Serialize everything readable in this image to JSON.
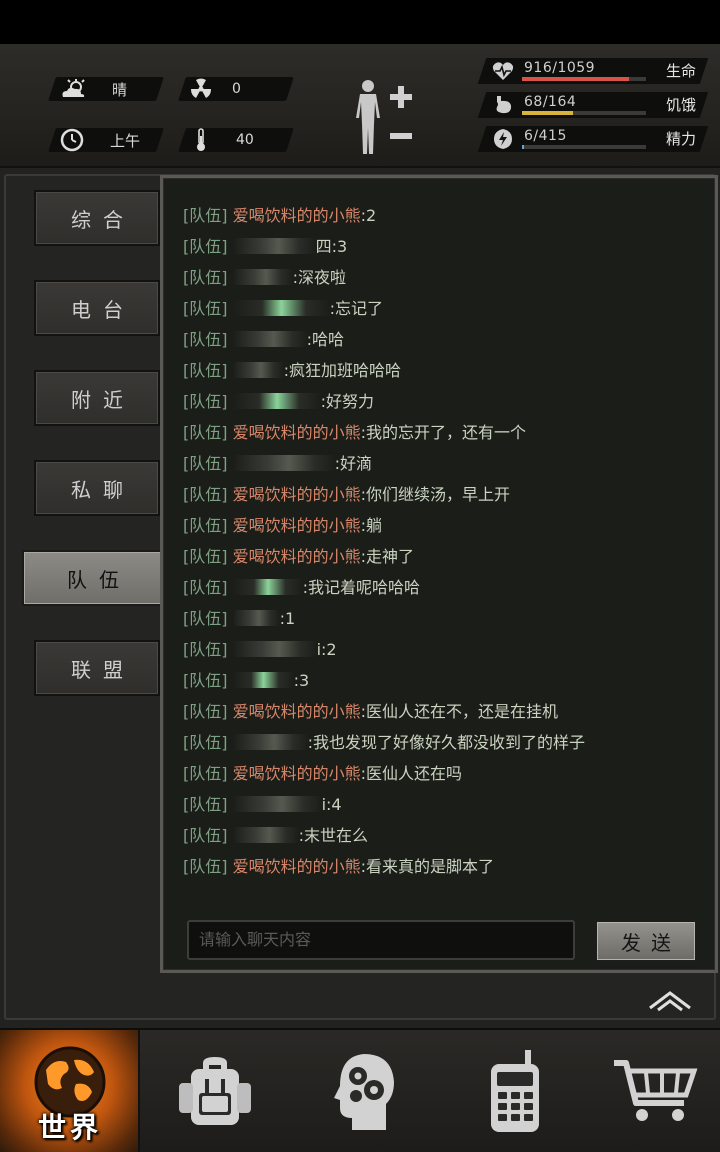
{
  "hud": {
    "weather": {
      "icon": "partly-cloudy-icon",
      "label": "晴"
    },
    "radiation": {
      "icon": "radiation-icon",
      "value": "0"
    },
    "time": {
      "icon": "clock-icon",
      "label": "上午"
    },
    "temperature": {
      "icon": "thermometer-icon",
      "value": "40"
    },
    "stats": [
      {
        "name": "生命",
        "value": "916/1059",
        "current": 916,
        "max": 1059,
        "color": "#d8534a",
        "icon": "heart-icon"
      },
      {
        "name": "饥饿",
        "value": "68/164",
        "current": 68,
        "max": 164,
        "color": "#d9b43a",
        "icon": "stomach-icon"
      },
      {
        "name": "精力",
        "value": "6/415",
        "current": 6,
        "max": 415,
        "color": "#6aa3d1",
        "icon": "energy-icon"
      }
    ]
  },
  "side_tabs": [
    {
      "label": "综合",
      "active": false
    },
    {
      "label": "电台",
      "active": false
    },
    {
      "label": "附近",
      "active": false
    },
    {
      "label": "私聊",
      "active": false
    },
    {
      "label": "队伍",
      "active": true
    },
    {
      "label": "联盟",
      "active": false
    }
  ],
  "chat": {
    "channel_label": "[队伍]",
    "messages": [
      {
        "name": "爱喝饮料的的小熊",
        "text": ":2"
      },
      {
        "name": "",
        "tail": "四",
        "text": ":3"
      },
      {
        "name": "",
        "tail": "",
        "text": ":深夜啦"
      },
      {
        "name": "",
        "tail": "",
        "text": ":忘记了"
      },
      {
        "name": "",
        "tail": "",
        "text": ":哈哈"
      },
      {
        "name": "",
        "tail": "",
        "text": ":疯狂加班哈哈哈"
      },
      {
        "name": "",
        "tail": "",
        "text": ":好努力"
      },
      {
        "name": "爱喝饮料的的小熊",
        "text": ":我的忘开了，还有一个"
      },
      {
        "name": "",
        "tail": "",
        "text": ":好滴"
      },
      {
        "name": "爱喝饮料的的小熊",
        "text": ":你们继续汤，早上开"
      },
      {
        "name": "爱喝饮料的的小熊",
        "text": ":躺"
      },
      {
        "name": "爱喝饮料的的小熊",
        "text": ":走神了"
      },
      {
        "name": "",
        "tail": "",
        "text": ":我记着呢哈哈哈"
      },
      {
        "name": "",
        "tail": "",
        "text": ":1"
      },
      {
        "name": "",
        "tail": "",
        "text": "i:2"
      },
      {
        "name": "",
        "tail": "",
        "text": ":3"
      },
      {
        "name": "爱喝饮料的的小熊",
        "text": ":医仙人还在不，还是在挂机"
      },
      {
        "name": "",
        "tail": "",
        "text": ":我也发现了好像好久都没收到了的样子"
      },
      {
        "name": "爱喝饮料的的小熊",
        "text": ":医仙人还在吗"
      },
      {
        "name": "",
        "tail": "",
        "text": "i:4"
      },
      {
        "name": "",
        "tail": "",
        "text": ":末世在么"
      },
      {
        "name": "爱喝饮料的的小熊",
        "text": ":看来真的是脚本了"
      }
    ],
    "input_placeholder": "请输入聊天内容",
    "send_label": "发送"
  },
  "bottom_nav": {
    "world_label": "世界",
    "items": [
      {
        "name": "world",
        "icon": "globe-icon"
      },
      {
        "name": "backpack",
        "icon": "backpack-icon"
      },
      {
        "name": "skills",
        "icon": "head-gears-icon"
      },
      {
        "name": "radio",
        "icon": "walkie-talkie-icon"
      },
      {
        "name": "shop",
        "icon": "shopping-cart-icon"
      }
    ]
  }
}
